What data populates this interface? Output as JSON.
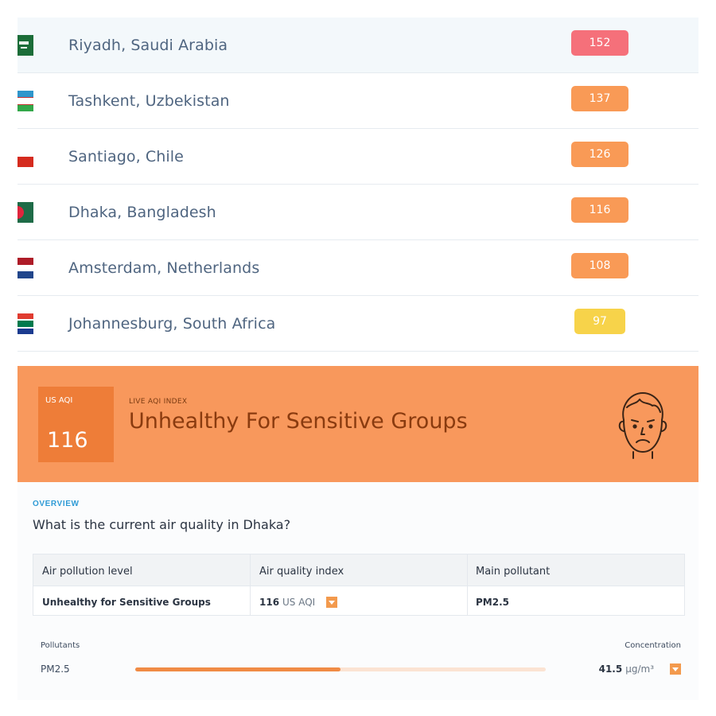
{
  "ranking": [
    {
      "city": "Riyadh, Saudi Arabia",
      "aqi": "152",
      "color": "#f5707a",
      "flag": "saudi-arabia-flag-icon"
    },
    {
      "city": "Tashkent, Uzbekistan",
      "aqi": "137",
      "color": "#f99a56",
      "flag": "uzbekistan-flag-icon"
    },
    {
      "city": "Santiago, Chile",
      "aqi": "126",
      "color": "#f99a56",
      "flag": "chile-flag-icon"
    },
    {
      "city": "Dhaka, Bangladesh",
      "aqi": "116",
      "color": "#f99a56",
      "flag": "bangladesh-flag-icon"
    },
    {
      "city": "Amsterdam, Netherlands",
      "aqi": "108",
      "color": "#f99a56",
      "flag": "netherlands-flag-icon"
    },
    {
      "city": "Johannesburg, South Africa",
      "aqi": "97",
      "color": "#f7d34a",
      "flag": "south-africa-flag-icon"
    }
  ],
  "banner": {
    "aqi_label": "US AQI",
    "aqi_value": "116",
    "live_label": "LIVE AQI INDEX",
    "status": "Unhealthy For Sensitive Groups",
    "background": "#f8985c",
    "box_color": "#ee7d38",
    "face_icon": "sad-face-icon"
  },
  "overview": {
    "label": "OVERVIEW",
    "question": "What is the current air quality in Dhaka?",
    "table": {
      "headers": [
        "Air pollution level",
        "Air quality index",
        "Main pollutant"
      ],
      "pollution_level": "Unhealthy for Sensitive Groups",
      "aqi_value": "116",
      "aqi_unit": "US AQI",
      "main_pollutant": "PM2.5"
    },
    "pollutants": {
      "header_left": "Pollutants",
      "header_right": "Concentration",
      "items": [
        {
          "name": "PM2.5",
          "value": "41.5",
          "unit": "µg/m³",
          "level": 0.5
        }
      ]
    }
  }
}
